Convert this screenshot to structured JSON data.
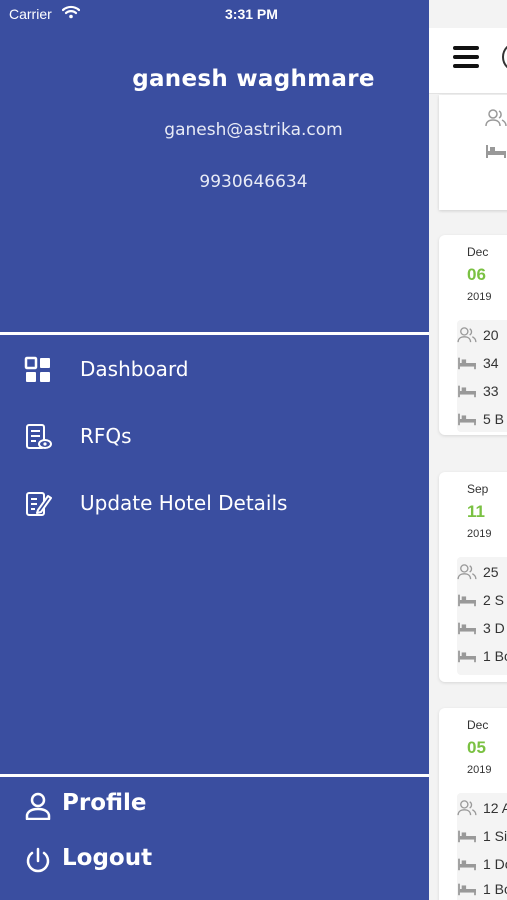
{
  "status_bar": {
    "carrier": "Carrier",
    "time": "3:31 PM"
  },
  "user": {
    "name": "ganesh waghmare",
    "email": "ganesh@astrika.com",
    "phone": "9930646634"
  },
  "menu": [
    {
      "label": "Dashboard",
      "icon": "dashboard-icon"
    },
    {
      "label": "RFQs",
      "icon": "rfq-document-icon"
    },
    {
      "label": "Update Hotel Details",
      "icon": "edit-document-icon"
    }
  ],
  "footer_menu": [
    {
      "label": "Profile",
      "icon": "person-icon"
    },
    {
      "label": "Logout",
      "icon": "power-icon"
    }
  ],
  "background_cards": [
    {
      "month": "Dec",
      "day": "06",
      "year": "2019",
      "rows": [
        "20",
        "34",
        "33",
        "5 B"
      ]
    },
    {
      "month": "Sep",
      "day": "11",
      "year": "2019",
      "rows": [
        "25",
        "2 S",
        "3 D",
        "1 Bo"
      ]
    },
    {
      "month": "Dec",
      "day": "05",
      "year": "2019",
      "rows": [
        "12 A",
        "1 Si",
        "1 Do",
        "1 Bo"
      ]
    }
  ],
  "colors": {
    "drawer_bg": "#3a4ea0",
    "accent_green": "#7ac142"
  }
}
